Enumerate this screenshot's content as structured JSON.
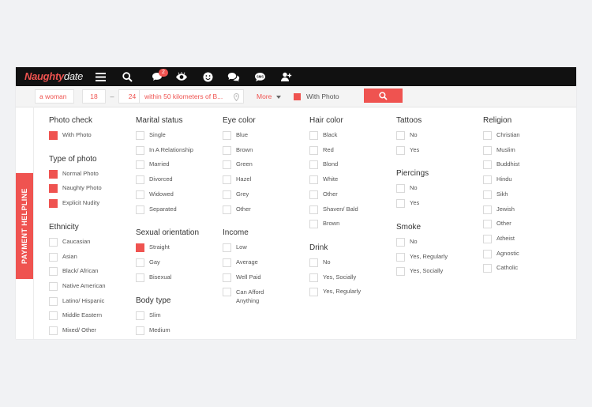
{
  "logo": {
    "part1": "Naughty",
    "part2": "date"
  },
  "nav": {
    "chat_badge": "2"
  },
  "search": {
    "gender": "a woman",
    "age_min": "18",
    "age_sep": "–",
    "age_max": "24",
    "location": "within 50 kilometers of B...",
    "more_label": "More",
    "with_photo_label": "With Photo"
  },
  "side_tab": {
    "label": "PAYMENT HELPLINE"
  },
  "colors": {
    "accent": "#ef5350",
    "topbar": "#111111"
  },
  "columns": [
    {
      "sections": [
        {
          "title": "Photo check",
          "options": [
            {
              "label": "With Photo",
              "checked": true
            }
          ]
        },
        {
          "title": "Type of photo",
          "options": [
            {
              "label": "Normal Photo",
              "checked": true
            },
            {
              "label": "Naughty Photo",
              "checked": true
            },
            {
              "label": "Explicit Nudity",
              "checked": true
            }
          ]
        },
        {
          "title": "Ethnicity",
          "options": [
            {
              "label": "Caucasian"
            },
            {
              "label": "Asian"
            },
            {
              "label": "Black/ African"
            },
            {
              "label": "Native American"
            },
            {
              "label": "Latino/ Hispanic"
            },
            {
              "label": "Middle Eastern"
            },
            {
              "label": "Mixed/ Other"
            }
          ]
        }
      ]
    },
    {
      "sections": [
        {
          "title": "Marital status",
          "options": [
            {
              "label": "Single"
            },
            {
              "label": "In A Relationship"
            },
            {
              "label": "Married"
            },
            {
              "label": "Divorced"
            },
            {
              "label": "Widowed"
            },
            {
              "label": "Separated"
            }
          ]
        },
        {
          "title": "Sexual orientation",
          "options": [
            {
              "label": "Straight",
              "checked": true
            },
            {
              "label": "Gay"
            },
            {
              "label": "Bisexual"
            }
          ]
        },
        {
          "title": "Body type",
          "options": [
            {
              "label": "Slim"
            },
            {
              "label": "Medium"
            }
          ]
        }
      ]
    },
    {
      "sections": [
        {
          "title": "Eye color",
          "options": [
            {
              "label": "Blue"
            },
            {
              "label": "Brown"
            },
            {
              "label": "Green"
            },
            {
              "label": "Hazel"
            },
            {
              "label": "Grey"
            },
            {
              "label": "Other"
            }
          ]
        },
        {
          "title": "Income",
          "options": [
            {
              "label": "Low"
            },
            {
              "label": "Average"
            },
            {
              "label": "Well Paid"
            },
            {
              "label": "Can Afford Anything",
              "two_line": true
            }
          ]
        }
      ]
    },
    {
      "sections": [
        {
          "title": "Hair color",
          "options": [
            {
              "label": "Black"
            },
            {
              "label": "Red"
            },
            {
              "label": "Blond"
            },
            {
              "label": "White"
            },
            {
              "label": "Other"
            },
            {
              "label": "Shaven/ Bald"
            },
            {
              "label": "Brown"
            }
          ]
        },
        {
          "title": "Drink",
          "options": [
            {
              "label": "No"
            },
            {
              "label": "Yes, Socially"
            },
            {
              "label": "Yes, Regularly"
            }
          ]
        }
      ]
    },
    {
      "sections": [
        {
          "title": "Tattoos",
          "options": [
            {
              "label": "No"
            },
            {
              "label": "Yes"
            }
          ]
        },
        {
          "title": "Piercings",
          "options": [
            {
              "label": "No"
            },
            {
              "label": "Yes"
            }
          ]
        },
        {
          "title": "Smoke",
          "options": [
            {
              "label": "No"
            },
            {
              "label": "Yes, Regularly"
            },
            {
              "label": "Yes, Socially"
            }
          ]
        }
      ]
    },
    {
      "sections": [
        {
          "title": "Religion",
          "options": [
            {
              "label": "Christian"
            },
            {
              "label": "Muslim"
            },
            {
              "label": "Buddhist"
            },
            {
              "label": "Hindu"
            },
            {
              "label": "Sikh"
            },
            {
              "label": "Jewish"
            },
            {
              "label": "Other"
            },
            {
              "label": "Atheist"
            },
            {
              "label": "Agnostic"
            },
            {
              "label": "Catholic"
            }
          ]
        }
      ]
    }
  ]
}
